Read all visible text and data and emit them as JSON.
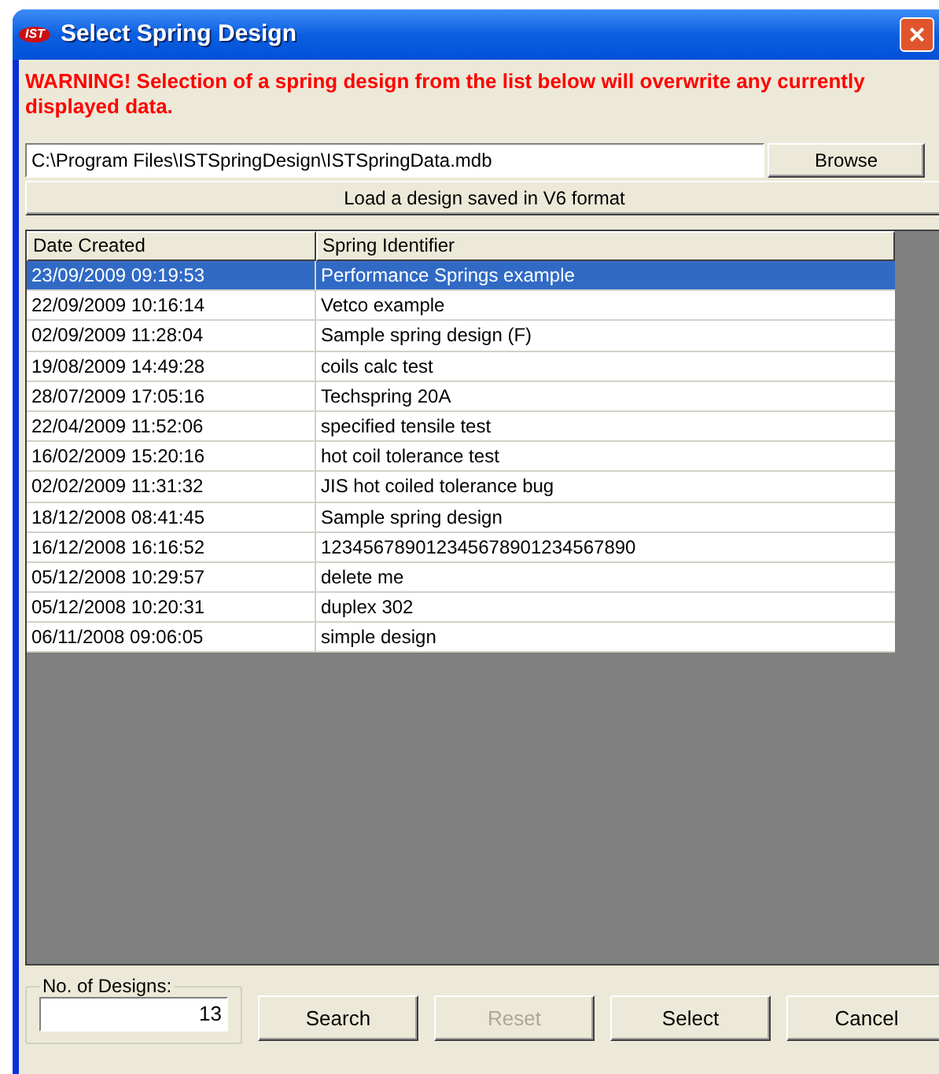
{
  "window": {
    "logo": "IST",
    "title": "Select Spring Design",
    "close": "×"
  },
  "warning": "WARNING! Selection of a spring design from the list below will overwrite any currently displayed data.",
  "path_field": {
    "value": "C:\\Program Files\\ISTSpringDesign\\ISTSpringData.mdb"
  },
  "browse_button": "Browse",
  "load_v6_button": "Load a design saved in V6 format",
  "table": {
    "columns": [
      "Date Created",
      "Spring Identifier"
    ],
    "rows": [
      {
        "date": "23/09/2009 09:19:53",
        "identifier": "Performance Springs example",
        "selected": true
      },
      {
        "date": "22/09/2009 10:16:14",
        "identifier": "Vetco example",
        "selected": false
      },
      {
        "date": "02/09/2009 11:28:04",
        "identifier": "Sample spring design (F)",
        "selected": false
      },
      {
        "date": "19/08/2009 14:49:28",
        "identifier": "coils calc test",
        "selected": false
      },
      {
        "date": "28/07/2009 17:05:16",
        "identifier": "Techspring 20A",
        "selected": false
      },
      {
        "date": "22/04/2009 11:52:06",
        "identifier": "specified tensile test",
        "selected": false
      },
      {
        "date": "16/02/2009 15:20:16",
        "identifier": "hot coil tolerance test",
        "selected": false
      },
      {
        "date": "02/02/2009 11:31:32",
        "identifier": "JIS hot coiled tolerance bug",
        "selected": false
      },
      {
        "date": "18/12/2008 08:41:45",
        "identifier": "Sample spring design",
        "selected": false
      },
      {
        "date": "16/12/2008 16:16:52",
        "identifier": "123456789012345678901234567890",
        "selected": false
      },
      {
        "date": "05/12/2008 10:29:57",
        "identifier": "delete me",
        "selected": false
      },
      {
        "date": "05/12/2008 10:20:31",
        "identifier": "duplex 302",
        "selected": false
      },
      {
        "date": "06/11/2008 09:06:05",
        "identifier": "simple design",
        "selected": false
      }
    ]
  },
  "designs_count": {
    "label": "No. of Designs:",
    "value": "13"
  },
  "buttons": [
    {
      "label": "Search",
      "disabled": false
    },
    {
      "label": "Reset",
      "disabled": true
    },
    {
      "label": "Select",
      "disabled": false
    },
    {
      "label": "Cancel",
      "disabled": false
    }
  ]
}
